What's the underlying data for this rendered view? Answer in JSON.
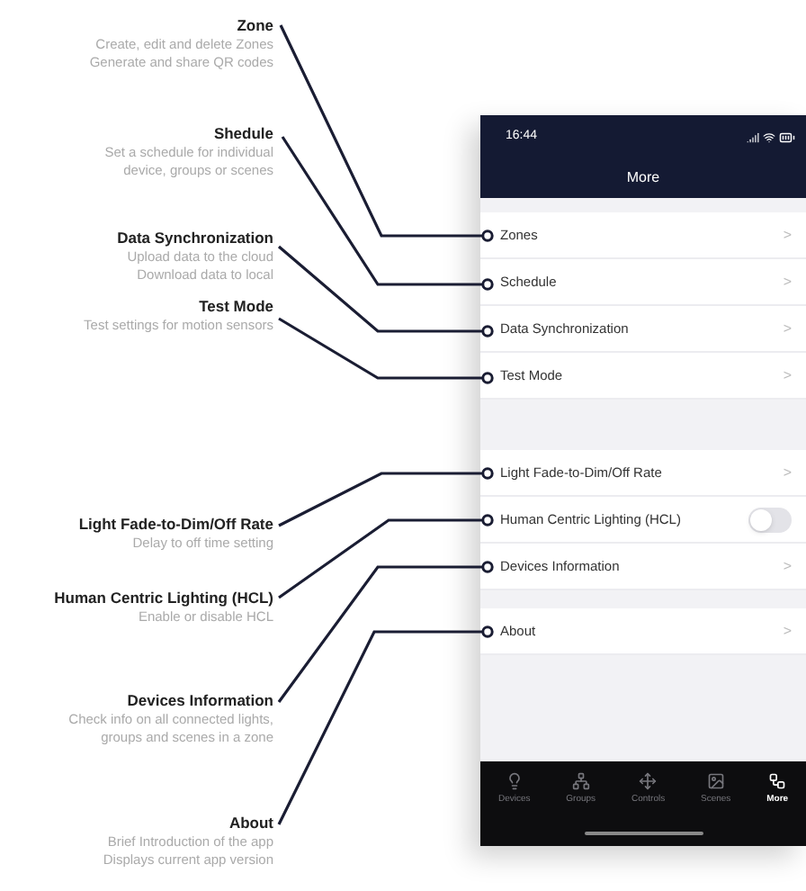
{
  "annotations": [
    {
      "title": "Zone",
      "lines": [
        "Create, edit and delete Zones",
        "Generate and share QR codes"
      ]
    },
    {
      "title": "Shedule",
      "lines": [
        "Set a schedule for individual",
        "device, groups or scenes"
      ]
    },
    {
      "title": "Data Synchronization",
      "lines": [
        "Upload data to the cloud",
        "Download data to local"
      ]
    },
    {
      "title": "Test Mode",
      "lines": [
        "Test settings for motion sensors"
      ]
    },
    {
      "title": "Light Fade-to-Dim/Off Rate",
      "lines": [
        "Delay to off time setting"
      ]
    },
    {
      "title": "Human Centric Lighting (HCL)",
      "lines": [
        "Enable or disable HCL"
      ]
    },
    {
      "title": "Devices Information",
      "lines": [
        "Check info on all connected lights,",
        "groups and scenes in a zone"
      ]
    },
    {
      "title": "About",
      "lines": [
        "Brief Introduction of the app",
        "Displays current app version"
      ]
    }
  ],
  "phone": {
    "time": "16:44",
    "title": "More",
    "groups": [
      [
        {
          "kind": "link",
          "label": "Zones",
          "chevron": ">"
        },
        {
          "kind": "link",
          "label": "Schedule",
          "chevron": ">"
        },
        {
          "kind": "link",
          "label": "Data Synchronization",
          "chevron": ">"
        },
        {
          "kind": "link",
          "label": "Test Mode",
          "chevron": ">"
        }
      ],
      [
        {
          "kind": "link",
          "label": "Light Fade-to-Dim/Off Rate",
          "chevron": ">"
        },
        {
          "kind": "toggle",
          "label": "Human Centric Lighting (HCL)",
          "on": false
        },
        {
          "kind": "link",
          "label": "Devices Information",
          "chevron": ">"
        }
      ],
      [
        {
          "kind": "link",
          "label": "About",
          "chevron": ">"
        }
      ]
    ],
    "tabs": [
      {
        "kind": "devices",
        "label": "Devices",
        "selected": false
      },
      {
        "kind": "groups",
        "label": "Groups",
        "selected": false
      },
      {
        "kind": "controls",
        "label": "Controls",
        "selected": false
      },
      {
        "kind": "scenes",
        "label": "Scenes",
        "selected": false
      },
      {
        "kind": "more",
        "label": "More",
        "selected": true
      }
    ]
  }
}
